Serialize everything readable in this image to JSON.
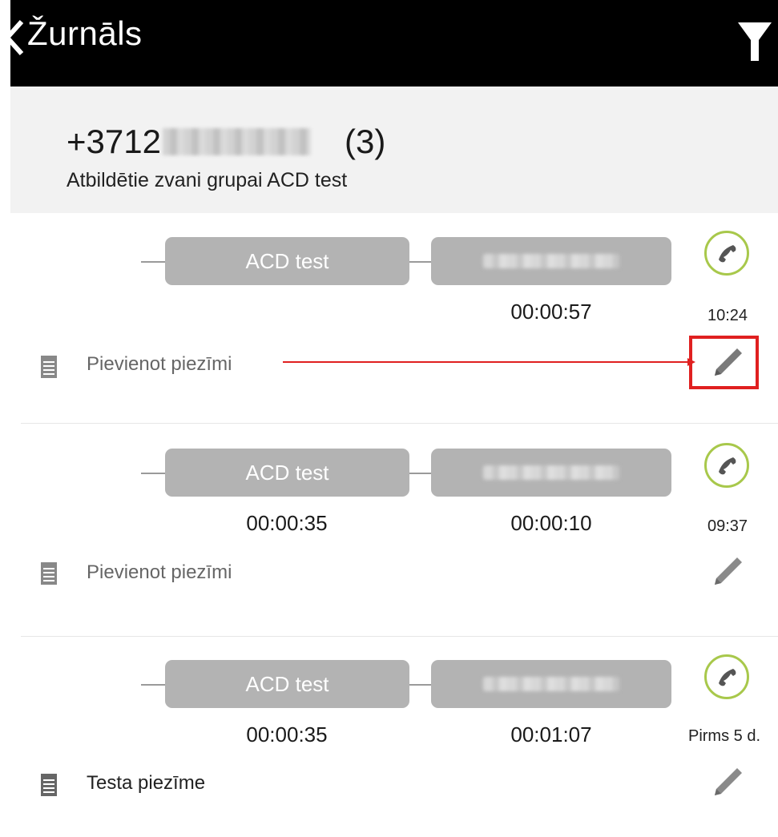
{
  "topbar": {
    "title": "Žurnāls",
    "back_icon": "chevron-left-icon",
    "filter_icon": "filter-funnel-icon"
  },
  "header": {
    "phone_prefix": "+3712",
    "phone_count": "(3)",
    "subtitle": "Atbildētie zvani grupai ACD test"
  },
  "calls": [
    {
      "group": "ACD test",
      "group_duration": "",
      "agent_duration": "00:00:57",
      "time": "10:24",
      "note": "Pievienot piezīmi",
      "note_is_placeholder": true
    },
    {
      "group": "ACD test",
      "group_duration": "00:00:35",
      "agent_duration": "00:00:10",
      "time": "09:37",
      "note": "Pievienot piezīmi",
      "note_is_placeholder": true
    },
    {
      "group": "ACD test",
      "group_duration": "00:00:35",
      "agent_duration": "00:01:07",
      "time": "Pirms 5 d.",
      "note": "Testa piezīme",
      "note_is_placeholder": false
    }
  ],
  "colors": {
    "accent_green": "#a8c84b",
    "pill_gray": "#b3b3b3",
    "highlight_red": "#e02020"
  }
}
